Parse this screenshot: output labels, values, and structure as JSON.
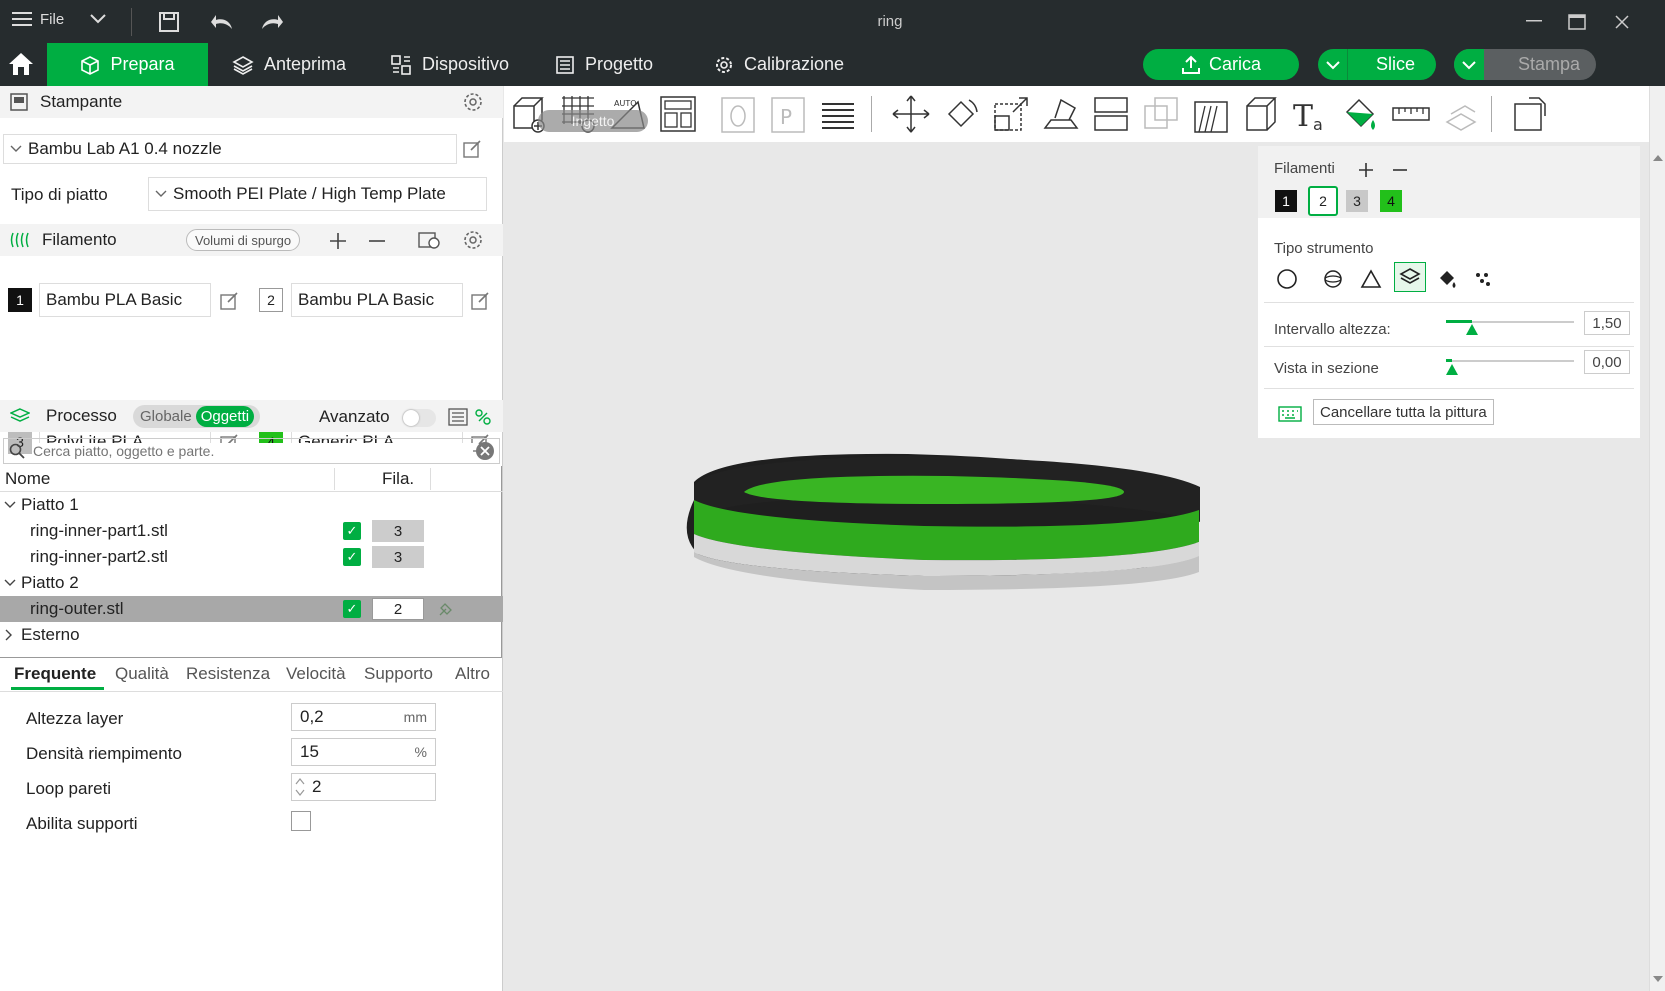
{
  "window": {
    "title": "ring",
    "file_menu": "File"
  },
  "nav": {
    "tabs": [
      "Prepara",
      "Anteprima",
      "Dispositivo",
      "Progetto",
      "Calibrazione"
    ],
    "carica": "Carica",
    "slice": "Slice",
    "stampa": "Stampa"
  },
  "printer": {
    "header": "Stampante",
    "name": "Bambu Lab A1 0.4 nozzle",
    "plate_type_label": "Tipo di piatto",
    "plate_type": "Smooth PEI Plate / High Temp Plate"
  },
  "filament": {
    "header": "Filamento",
    "purge_button": "Volumi di spurgo",
    "items": [
      {
        "num": "1",
        "name": "Bambu PLA Basic",
        "color": "#111111"
      },
      {
        "num": "2",
        "name": "Bambu PLA Basic",
        "color": "#ffffff"
      },
      {
        "num": "3",
        "name": "PolyLite PLA",
        "color": "#bdbdbd"
      },
      {
        "num": "4",
        "name": "Generic PLA",
        "color": "#22c01a"
      }
    ]
  },
  "process": {
    "header": "Processo",
    "toggle_global": "Globale",
    "toggle_objects": "Oggetti",
    "advanced": "Avanzato",
    "search_placeholder": "Cerca piatto, oggetto e parte."
  },
  "objects": {
    "col_name": "Nome",
    "col_fila": "Fila.",
    "tree": [
      {
        "label": "Piatto 1"
      },
      {
        "label": "ring-inner-part1.stl",
        "fila": "3"
      },
      {
        "label": "ring-inner-part2.stl",
        "fila": "3"
      },
      {
        "label": "Piatto 2"
      },
      {
        "label": "ring-outer.stl",
        "fila": "2"
      },
      {
        "label": "Esterno"
      }
    ]
  },
  "settings_tabs": [
    "Frequente",
    "Qualità",
    "Resistenza",
    "Velocità",
    "Supporto",
    "Altro"
  ],
  "params": {
    "layer_height": {
      "label": "Altezza layer",
      "value": "0,2",
      "unit": "mm"
    },
    "infill": {
      "label": "Densità riempimento",
      "value": "15",
      "unit": "%"
    },
    "walls": {
      "label": "Loop pareti",
      "value": "2"
    },
    "supports": {
      "label": "Abilita supporti"
    }
  },
  "toolbar": {
    "tooltip": "Ingetto"
  },
  "paint": {
    "filaments_label": "Filamenti",
    "tool_type_label": "Tipo strumento",
    "height_range_label": "Intervallo altezza:",
    "height_range_value": "1,50",
    "section_view_label": "Vista in sezione",
    "section_view_value": "0,00",
    "clear_button": "Cancellare tutta la pittura",
    "height_range_level": 0.2,
    "section_view_level": 0.05
  },
  "colors": {
    "accent": "#00ae42",
    "titlebar": "#262c2e"
  }
}
